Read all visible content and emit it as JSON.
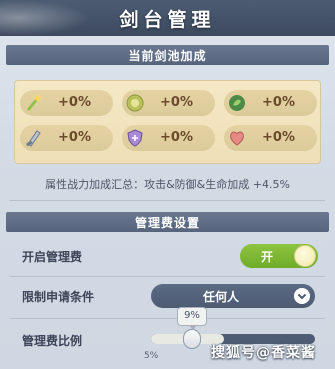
{
  "header": {
    "title": "剑台管理"
  },
  "bonus_section": {
    "title": "当前剑池加成",
    "bonuses": [
      {
        "icon": "sword-gem-icon",
        "value": "+0%"
      },
      {
        "icon": "target-icon",
        "value": "+0%"
      },
      {
        "icon": "leaf-icon",
        "value": "+0%"
      },
      {
        "icon": "blade-icon",
        "value": "+0%"
      },
      {
        "icon": "shield-icon",
        "value": "+0%"
      },
      {
        "icon": "heart-icon",
        "value": "+0%"
      }
    ],
    "summary": "属性战力加成汇总：攻击&防御&生命加成 +4.5%"
  },
  "fee_section": {
    "title": "管理费设置",
    "enable_label": "开启管理费",
    "toggle_text": "开",
    "toggle_on": true,
    "restrict_label": "限制申请条件",
    "restrict_value": "任何人",
    "ratio_label": "管理费比例",
    "ratio_value": "9%",
    "ratio_min_label": "5%",
    "ratio_fraction": 0.09
  },
  "watermark": "搜狐号@香菜酱",
  "colors": {
    "accent_green": "#7cb832",
    "header": "#46536a",
    "bonus_text": "#6b4a2c"
  }
}
